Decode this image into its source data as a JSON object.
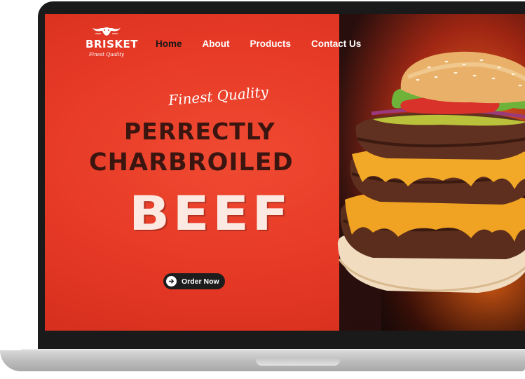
{
  "brand": {
    "name": "BRISKET",
    "tagline": "Finest Quality"
  },
  "nav": {
    "items": [
      {
        "label": "Home",
        "active": true
      },
      {
        "label": "About",
        "active": false
      },
      {
        "label": "Products",
        "active": false
      },
      {
        "label": "Contact Us",
        "active": false
      }
    ]
  },
  "hero": {
    "script": "Finest Quality",
    "line1": "PERRECTLY",
    "line2": "CHARBROILED",
    "line3": "BEEF",
    "cta": "Order Now"
  },
  "icons": {
    "logo": "bull-head-icon",
    "cta": "arrow-right-icon"
  },
  "colors": {
    "background": "#e63a26",
    "heading": "#3b1510",
    "nav_active": "#161616",
    "button": "#1d1d1d"
  }
}
